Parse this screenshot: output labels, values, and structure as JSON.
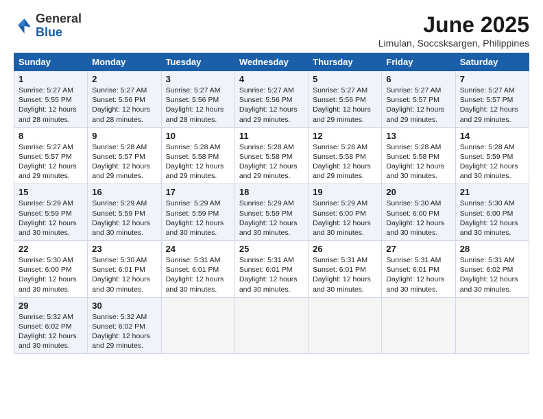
{
  "header": {
    "logo_general": "General",
    "logo_blue": "Blue",
    "title": "June 2025",
    "subtitle": "Limulan, Soccsksargen, Philippines"
  },
  "columns": [
    "Sunday",
    "Monday",
    "Tuesday",
    "Wednesday",
    "Thursday",
    "Friday",
    "Saturday"
  ],
  "weeks": [
    {
      "days": [
        {
          "num": "1",
          "rise": "5:27 AM",
          "set": "5:55 PM",
          "daylight": "12 hours and 28 minutes."
        },
        {
          "num": "2",
          "rise": "5:27 AM",
          "set": "5:56 PM",
          "daylight": "12 hours and 28 minutes."
        },
        {
          "num": "3",
          "rise": "5:27 AM",
          "set": "5:56 PM",
          "daylight": "12 hours and 28 minutes."
        },
        {
          "num": "4",
          "rise": "5:27 AM",
          "set": "5:56 PM",
          "daylight": "12 hours and 29 minutes."
        },
        {
          "num": "5",
          "rise": "5:27 AM",
          "set": "5:56 PM",
          "daylight": "12 hours and 29 minutes."
        },
        {
          "num": "6",
          "rise": "5:27 AM",
          "set": "5:57 PM",
          "daylight": "12 hours and 29 minutes."
        },
        {
          "num": "7",
          "rise": "5:27 AM",
          "set": "5:57 PM",
          "daylight": "12 hours and 29 minutes."
        }
      ]
    },
    {
      "days": [
        {
          "num": "8",
          "rise": "5:27 AM",
          "set": "5:57 PM",
          "daylight": "12 hours and 29 minutes."
        },
        {
          "num": "9",
          "rise": "5:28 AM",
          "set": "5:57 PM",
          "daylight": "12 hours and 29 minutes."
        },
        {
          "num": "10",
          "rise": "5:28 AM",
          "set": "5:58 PM",
          "daylight": "12 hours and 29 minutes."
        },
        {
          "num": "11",
          "rise": "5:28 AM",
          "set": "5:58 PM",
          "daylight": "12 hours and 29 minutes."
        },
        {
          "num": "12",
          "rise": "5:28 AM",
          "set": "5:58 PM",
          "daylight": "12 hours and 29 minutes."
        },
        {
          "num": "13",
          "rise": "5:28 AM",
          "set": "5:58 PM",
          "daylight": "12 hours and 30 minutes."
        },
        {
          "num": "14",
          "rise": "5:28 AM",
          "set": "5:59 PM",
          "daylight": "12 hours and 30 minutes."
        }
      ]
    },
    {
      "days": [
        {
          "num": "15",
          "rise": "5:29 AM",
          "set": "5:59 PM",
          "daylight": "12 hours and 30 minutes."
        },
        {
          "num": "16",
          "rise": "5:29 AM",
          "set": "5:59 PM",
          "daylight": "12 hours and 30 minutes."
        },
        {
          "num": "17",
          "rise": "5:29 AM",
          "set": "5:59 PM",
          "daylight": "12 hours and 30 minutes."
        },
        {
          "num": "18",
          "rise": "5:29 AM",
          "set": "5:59 PM",
          "daylight": "12 hours and 30 minutes."
        },
        {
          "num": "19",
          "rise": "5:29 AM",
          "set": "6:00 PM",
          "daylight": "12 hours and 30 minutes."
        },
        {
          "num": "20",
          "rise": "5:30 AM",
          "set": "6:00 PM",
          "daylight": "12 hours and 30 minutes."
        },
        {
          "num": "21",
          "rise": "5:30 AM",
          "set": "6:00 PM",
          "daylight": "12 hours and 30 minutes."
        }
      ]
    },
    {
      "days": [
        {
          "num": "22",
          "rise": "5:30 AM",
          "set": "6:00 PM",
          "daylight": "12 hours and 30 minutes."
        },
        {
          "num": "23",
          "rise": "5:30 AM",
          "set": "6:01 PM",
          "daylight": "12 hours and 30 minutes."
        },
        {
          "num": "24",
          "rise": "5:31 AM",
          "set": "6:01 PM",
          "daylight": "12 hours and 30 minutes."
        },
        {
          "num": "25",
          "rise": "5:31 AM",
          "set": "6:01 PM",
          "daylight": "12 hours and 30 minutes."
        },
        {
          "num": "26",
          "rise": "5:31 AM",
          "set": "6:01 PM",
          "daylight": "12 hours and 30 minutes."
        },
        {
          "num": "27",
          "rise": "5:31 AM",
          "set": "6:01 PM",
          "daylight": "12 hours and 30 minutes."
        },
        {
          "num": "28",
          "rise": "5:31 AM",
          "set": "6:02 PM",
          "daylight": "12 hours and 30 minutes."
        }
      ]
    },
    {
      "days": [
        {
          "num": "29",
          "rise": "5:32 AM",
          "set": "6:02 PM",
          "daylight": "12 hours and 30 minutes."
        },
        {
          "num": "30",
          "rise": "5:32 AM",
          "set": "6:02 PM",
          "daylight": "12 hours and 29 minutes."
        },
        null,
        null,
        null,
        null,
        null
      ]
    }
  ],
  "daylight_label": "Daylight:",
  "sunrise_label": "Sunrise:",
  "sunset_label": "Sunset:"
}
